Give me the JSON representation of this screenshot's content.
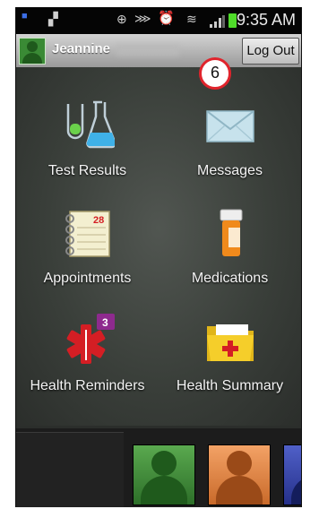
{
  "status_bar": {
    "time": "9:35 AM",
    "left_icon": "usb-debug-icon",
    "icons": [
      "location-icon",
      "vibrate-icon",
      "alarm-icon",
      "wifi-icon",
      "signal-icon",
      "battery-icon"
    ]
  },
  "user_bar": {
    "name": "Jeannine",
    "logout_label": "Log Out"
  },
  "callout": {
    "number": "6"
  },
  "tiles": [
    {
      "label": "Test Results",
      "icon": "lab-flask-icon"
    },
    {
      "label": "Messages",
      "icon": "envelope-icon"
    },
    {
      "label": "Appointments",
      "icon": "calendar-icon",
      "icon_text": "28"
    },
    {
      "label": "Medications",
      "icon": "pill-bottle-icon"
    },
    {
      "label": "Health Reminders",
      "icon": "star-of-life-icon",
      "badge": "3"
    },
    {
      "label": "Health Summary",
      "icon": "medical-folder-icon"
    }
  ],
  "dock": {
    "cards": [
      "green-avatar",
      "orange-avatar",
      "blue-avatar"
    ]
  },
  "colors": {
    "accent_green": "#3a8a35",
    "reminder_red": "#d41e24",
    "badge_purple": "#8e2a8e",
    "callout_red": "#e0242c"
  }
}
